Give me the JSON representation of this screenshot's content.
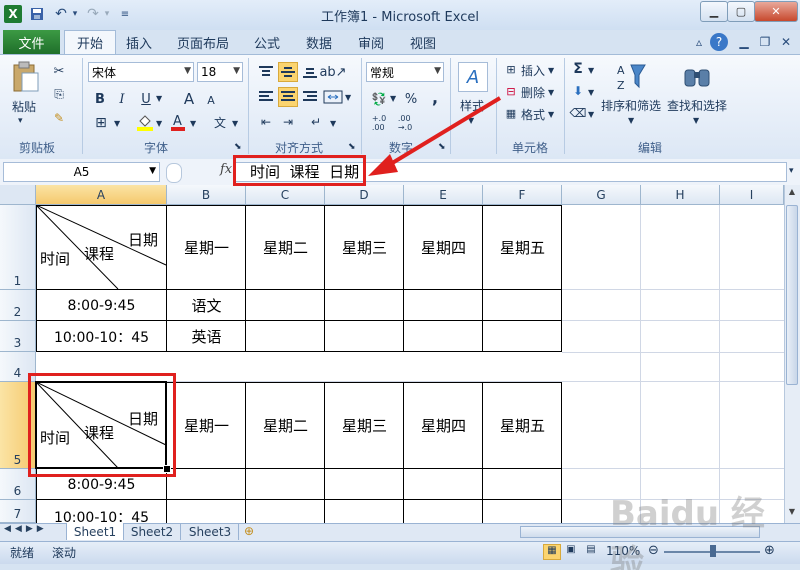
{
  "window": {
    "title": "工作簿1 - Microsoft Excel"
  },
  "ribbon_tabs": {
    "file": "文件",
    "home": "开始",
    "insert": "插入",
    "layout": "页面布局",
    "formula": "公式",
    "data": "数据",
    "review": "审阅",
    "view": "视图"
  },
  "clipboard": {
    "paste": "粘贴",
    "group": "剪贴板"
  },
  "font": {
    "name": "宋体",
    "size": "18",
    "bold": "B",
    "italic": "I",
    "underline": "U",
    "grow": "A",
    "shrink": "A",
    "group": "字体"
  },
  "alignment": {
    "group": "对齐方式"
  },
  "number": {
    "format": "常规",
    "percent": "%",
    "comma": ",",
    "group": "数字"
  },
  "styles": {
    "label": "样式"
  },
  "cells": {
    "insert": "插入",
    "delete": "删除",
    "format": "格式",
    "group": "单元格"
  },
  "editing": {
    "sigma": "Σ",
    "sort": "排序和筛选",
    "find": "查找和选择",
    "group": "编辑"
  },
  "formula_bar": {
    "name_box": "A5",
    "fx": "fx",
    "content": "时间  课程  日期"
  },
  "columns": [
    "A",
    "B",
    "C",
    "D",
    "E",
    "F",
    "G",
    "H",
    "I"
  ],
  "rows": [
    "1",
    "2",
    "3",
    "4",
    "5",
    "6",
    "7"
  ],
  "table": {
    "header_diag": {
      "date": "日期",
      "course": "课程",
      "time": "时间"
    },
    "days": [
      "星期一",
      "星期二",
      "星期三",
      "星期四",
      "星期五"
    ],
    "time1": "8:00-9:45",
    "time2": "10:00-10：45",
    "subject1": "语文",
    "subject2": "英语"
  },
  "sheets": [
    "Sheet1",
    "Sheet2",
    "Sheet3"
  ],
  "status": {
    "ready": "就绪",
    "scroll": "滚动",
    "zoom": "110%"
  },
  "watermark": "Baidu 经验",
  "colors": {
    "highlight": "#e0201e",
    "selected_header": "#f5c96e"
  }
}
